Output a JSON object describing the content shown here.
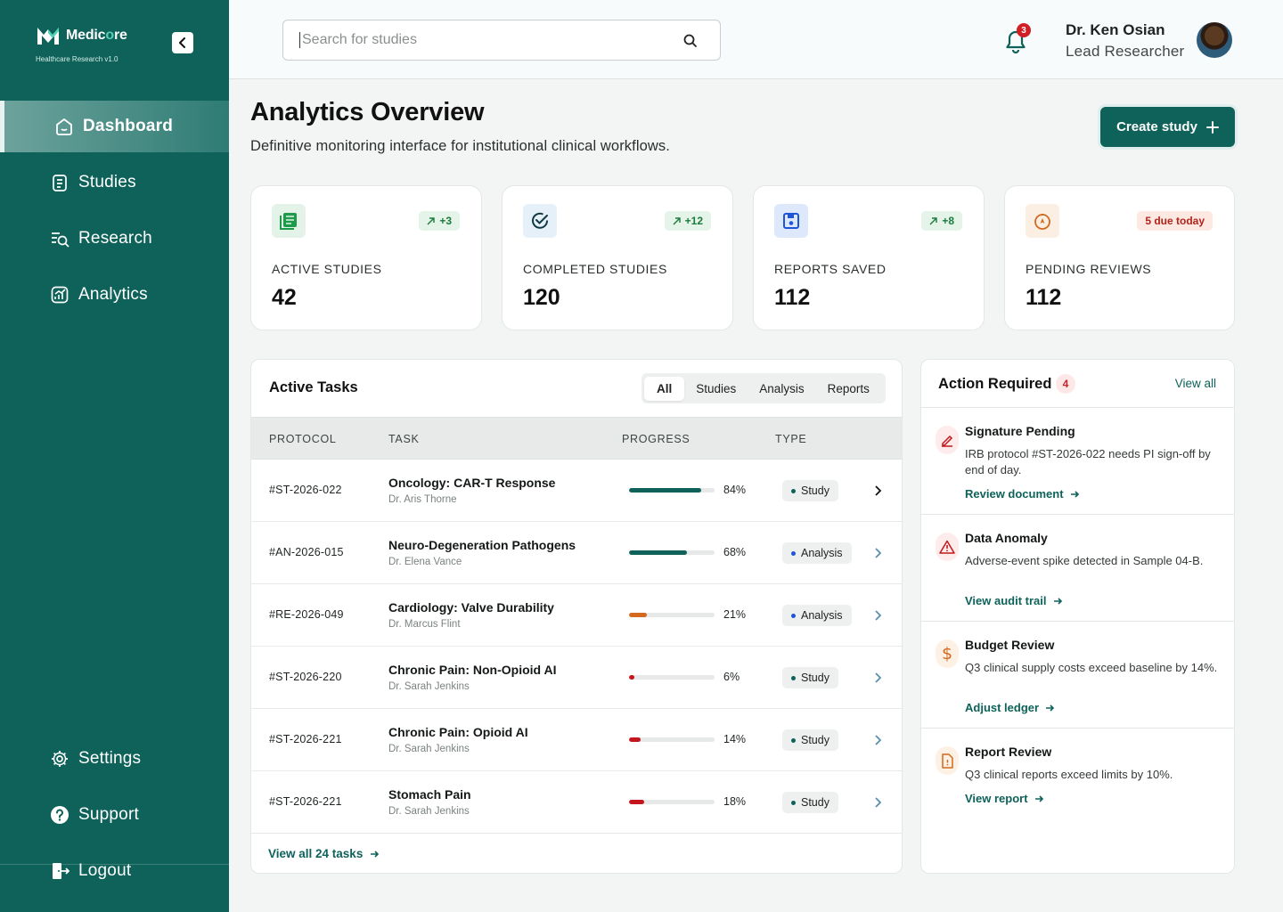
{
  "brand": {
    "name_main": "Medic",
    "name_accent": "o",
    "name_end": "re",
    "subtitle": "Healthcare Research v1.0"
  },
  "nav": {
    "items": [
      {
        "label": "Dashboard",
        "icon": "home-icon",
        "active": true
      },
      {
        "label": "Studies",
        "icon": "document-icon"
      },
      {
        "label": "Research",
        "icon": "research-icon"
      },
      {
        "label": "Analytics",
        "icon": "analytics-icon"
      }
    ],
    "bottom": [
      {
        "label": "Settings",
        "icon": "gear-icon"
      },
      {
        "label": "Support",
        "icon": "help-icon"
      },
      {
        "label": "Logout",
        "icon": "logout-icon"
      }
    ]
  },
  "header": {
    "search_placeholder": "Search for studies",
    "notification_count": "3",
    "user_name": "Dr. Ken Osian",
    "user_role": "Lead Researcher"
  },
  "page": {
    "title": "Analytics Overview",
    "subtitle": "Definitive monitoring interface for institutional clinical workflows.",
    "create_label": "Create study"
  },
  "stats": [
    {
      "label": "ACTIVE STUDIES",
      "value": "42",
      "badge": "+3",
      "icon": "list-icon"
    },
    {
      "label": "COMPLETED STUDIES",
      "value": "120",
      "badge": "+12",
      "icon": "check-circle-icon"
    },
    {
      "label": "REPORTS SAVED",
      "value": "112",
      "badge": "+8",
      "icon": "save-icon"
    },
    {
      "label": "PENDING REVIEWS",
      "value": "112",
      "badge": "5 due today",
      "icon": "compass-icon"
    }
  ],
  "tasks": {
    "title": "Active Tasks",
    "tabs": [
      "All",
      "Studies",
      "Analysis",
      "Reports"
    ],
    "columns": [
      "PROTOCOL",
      "TASK",
      "PROGRESS",
      "TYPE"
    ],
    "rows": [
      {
        "protocol": "#ST-2026-022",
        "task": "Oncology: CAR-T Response",
        "owner": "Dr. Aris Thorne",
        "progress": 84,
        "progress_label": "84%",
        "type": "Study",
        "bar_color": "#0e625a",
        "dot_color": "#0e625a"
      },
      {
        "protocol": "#AN-2026-015",
        "task": "Neuro-Degeneration Pathogens",
        "owner": "Dr. Elena Vance",
        "progress": 68,
        "progress_label": "68%",
        "type": "Analysis",
        "bar_color": "#0e625a",
        "dot_color": "#1f56d8"
      },
      {
        "protocol": "#RE-2026-049",
        "task": "Cardiology: Valve Durability",
        "owner": "Dr. Marcus Flint",
        "progress": 21,
        "progress_label": "21%",
        "type": "Analysis",
        "bar_color": "#d2691e",
        "dot_color": "#1f56d8"
      },
      {
        "protocol": "#ST-2026-220",
        "task": "Chronic Pain: Non-Opioid AI",
        "owner": "Dr. Sarah Jenkins",
        "progress": 6,
        "progress_label": "6%",
        "type": "Study",
        "bar_color": "#c4161c",
        "dot_color": "#0e625a"
      },
      {
        "protocol": "#ST-2026-221",
        "task": "Chronic Pain: Opioid AI",
        "owner": "Dr. Sarah Jenkins",
        "progress": 14,
        "progress_label": "14%",
        "type": "Study",
        "bar_color": "#c4161c",
        "dot_color": "#0e625a"
      },
      {
        "protocol": "#ST-2026-221",
        "task": "Stomach Pain",
        "owner": "Dr. Sarah Jenkins",
        "progress": 18,
        "progress_label": "18%",
        "type": "Study",
        "bar_color": "#c4161c",
        "dot_color": "#0e625a"
      }
    ],
    "view_all": "View all 24 tasks"
  },
  "actions": {
    "title": "Action Required",
    "count": "4",
    "view_all": "View all",
    "items": [
      {
        "title": "Signature Pending",
        "desc": "IRB protocol #ST-2026-022 needs PI sign-off by end of day.",
        "link": "Review document",
        "icon": "pen-icon"
      },
      {
        "title": "Data Anomaly",
        "desc": "Adverse-event spike detected in Sample 04-B.",
        "link": "View audit trail",
        "icon": "warning-icon"
      },
      {
        "title": "Budget Review",
        "desc": "Q3 clinical supply costs exceed baseline by 14%.",
        "link": "Adjust ledger",
        "icon": "dollar-icon"
      },
      {
        "title": "Report Review",
        "desc": "Q3 clinical reports exceed limits by 10%.",
        "link": "View report",
        "icon": "file-alert-icon"
      }
    ]
  },
  "colors": {
    "brand": "#0e625a",
    "accent": "#4fd3b7",
    "danger": "#c4161c",
    "warning": "#d2691e",
    "info": "#1f56d8"
  }
}
